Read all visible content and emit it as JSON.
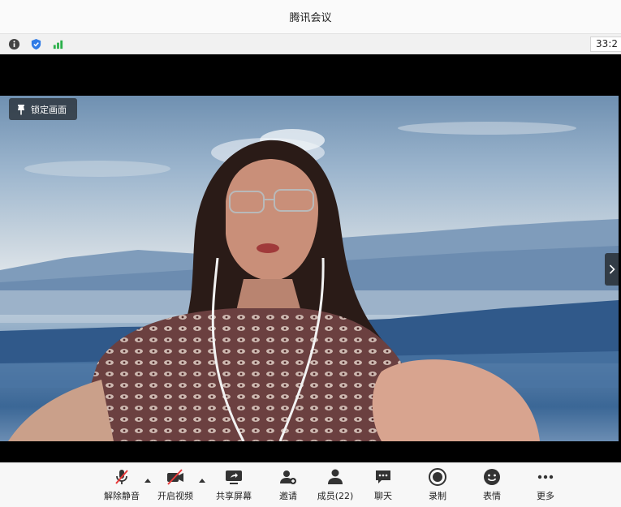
{
  "window": {
    "title": "腾讯会议"
  },
  "status_bar": {
    "icons": [
      "info-icon",
      "shield-icon",
      "signal-icon"
    ],
    "timer": "33:2"
  },
  "video": {
    "lock_view_label": "锁定画面"
  },
  "toolbar": {
    "unmute": "解除静音",
    "start_video": "开启视频",
    "share_screen": "共享屏幕",
    "invite": "邀请",
    "members": "成员(22)",
    "chat": "聊天",
    "record": "录制",
    "emoji": "表情",
    "more": "更多"
  },
  "colors": {
    "mute_slash": "#e83a3a",
    "icon": "#333333",
    "signal": "#2bb04a",
    "shield": "#2f7be6"
  }
}
